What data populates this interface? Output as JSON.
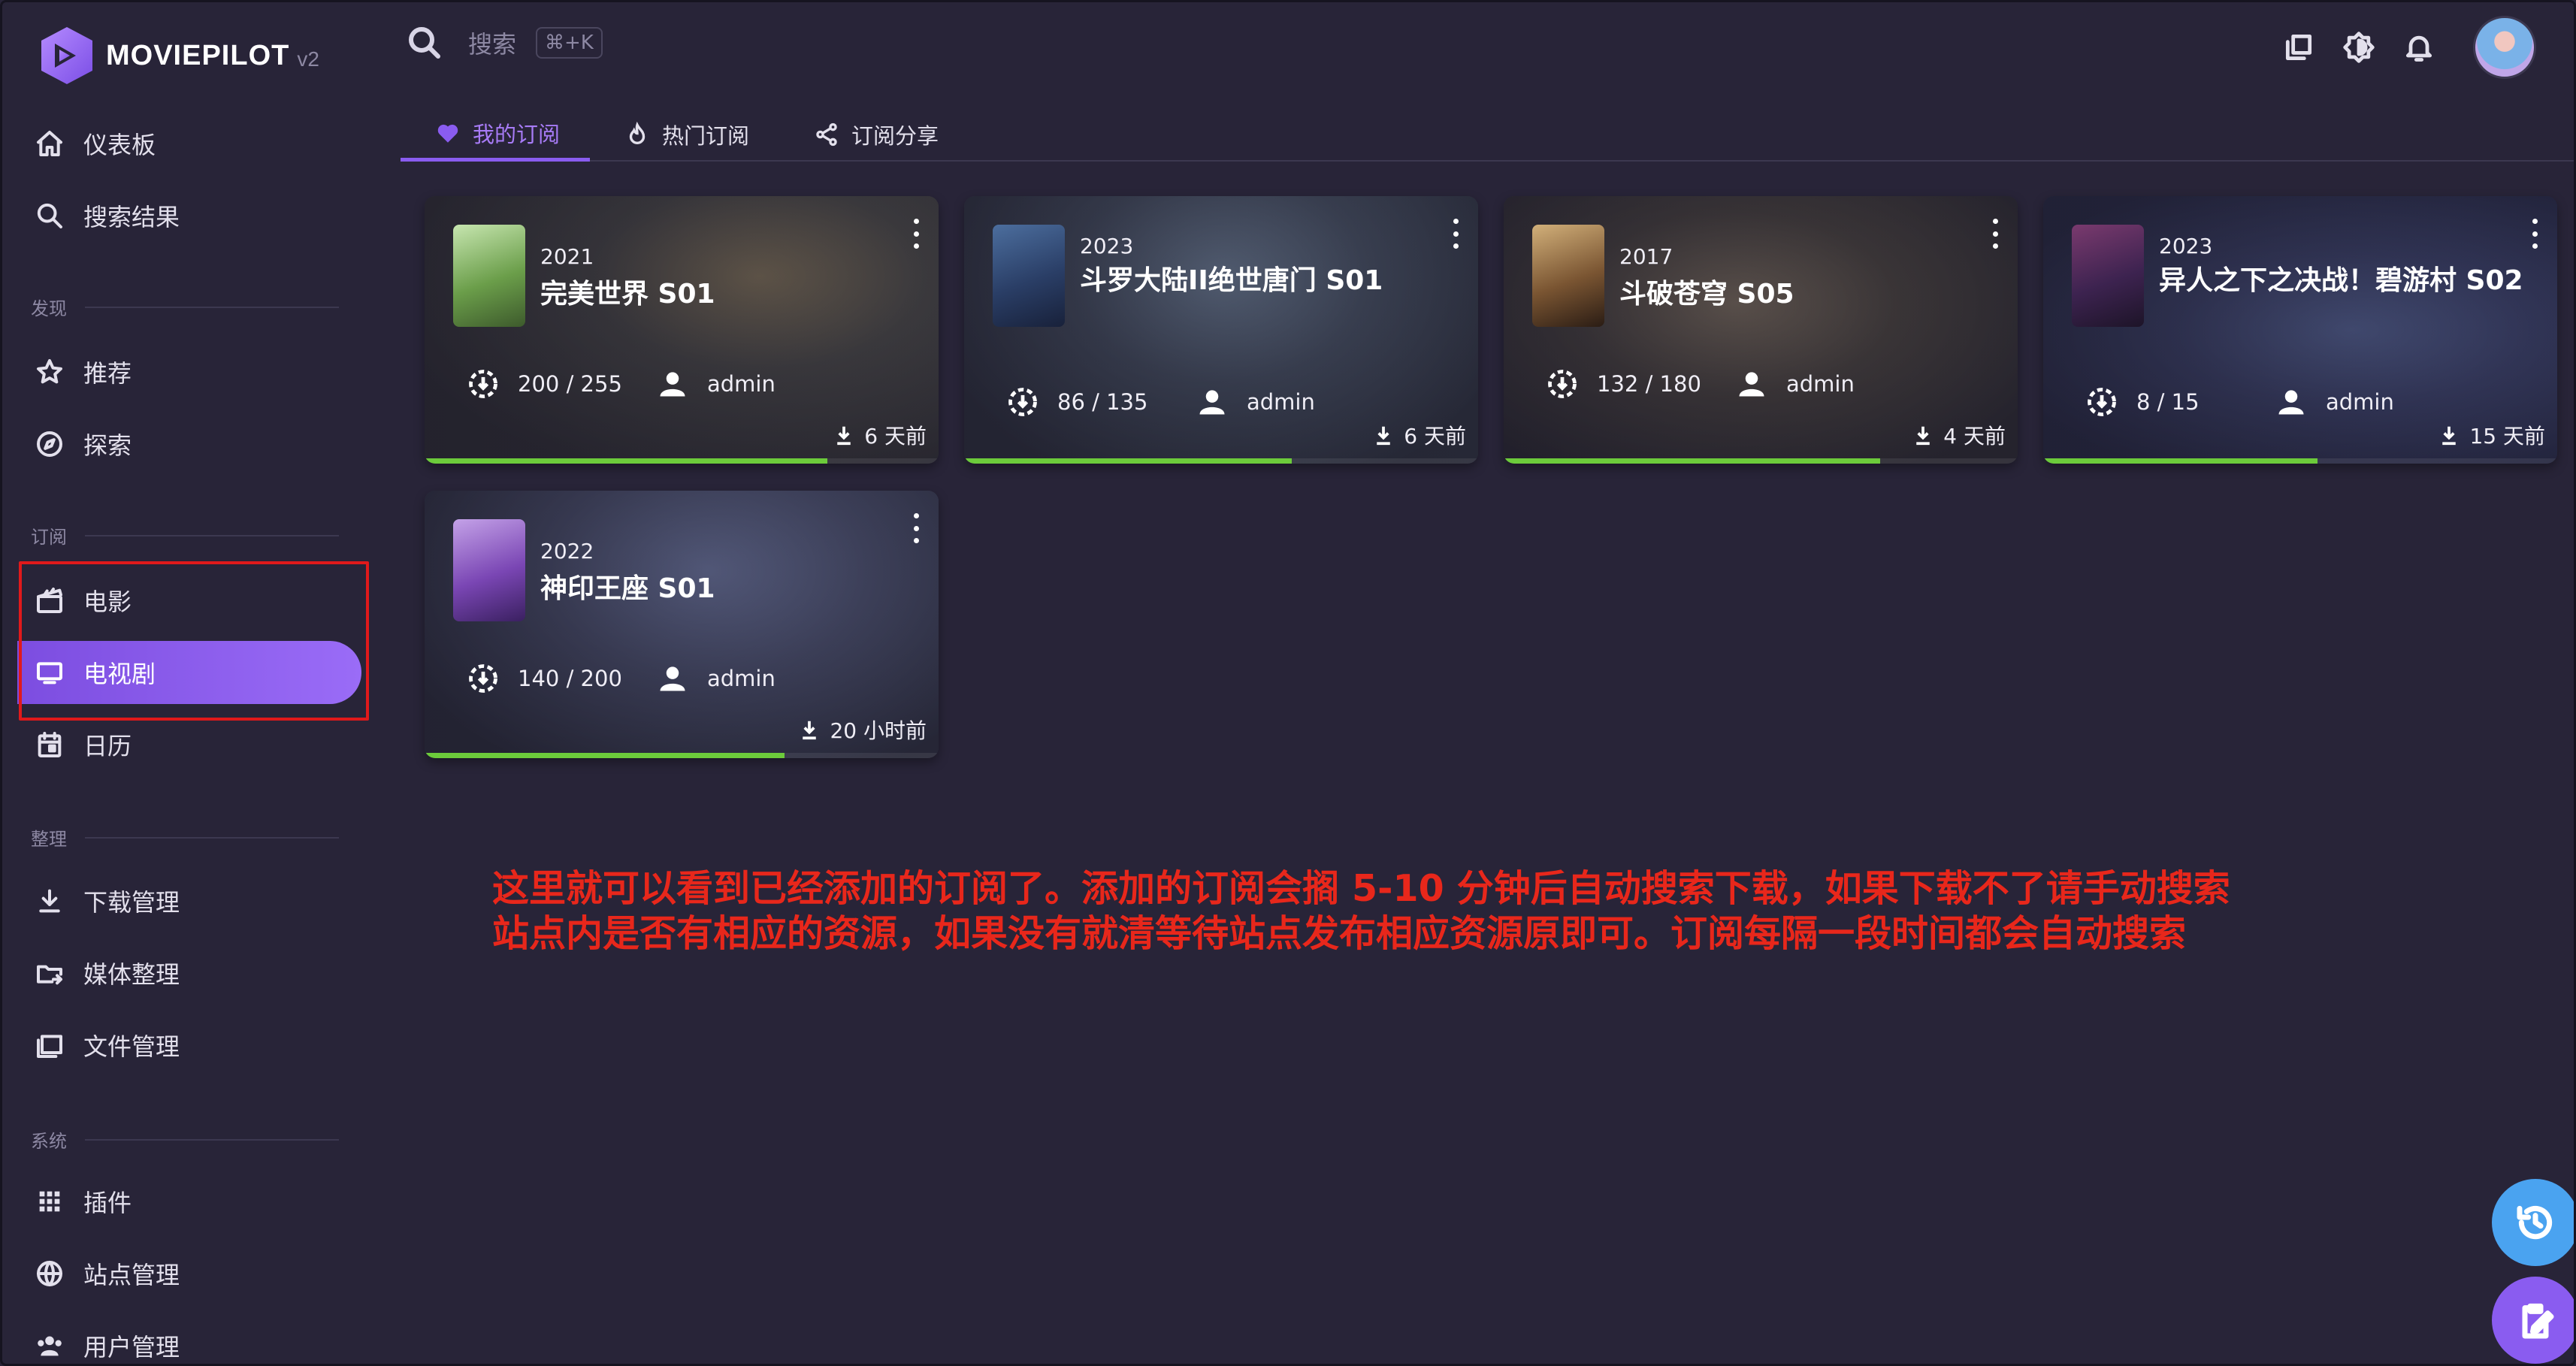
{
  "app": {
    "name": "MOVIEPILOT",
    "version": "v2"
  },
  "search": {
    "placeholder": "搜索",
    "shortcut": "⌘+K"
  },
  "sidebar": {
    "top_items": [
      {
        "label": "仪表板",
        "icon": "home-icon"
      },
      {
        "label": "搜索结果",
        "icon": "search-icon"
      }
    ],
    "sections": [
      {
        "title": "发现",
        "items": [
          {
            "label": "推荐",
            "icon": "star-icon"
          },
          {
            "label": "探索",
            "icon": "compass-icon"
          }
        ]
      },
      {
        "title": "订阅",
        "items": [
          {
            "label": "电影",
            "icon": "movie-clapper-icon"
          },
          {
            "label": "电视剧",
            "icon": "tv-icon",
            "active": true
          },
          {
            "label": "日历",
            "icon": "calendar-icon"
          }
        ]
      },
      {
        "title": "整理",
        "items": [
          {
            "label": "下载管理",
            "icon": "download-icon"
          },
          {
            "label": "媒体整理",
            "icon": "folder-move-icon"
          },
          {
            "label": "文件管理",
            "icon": "file-manager-icon"
          }
        ]
      },
      {
        "title": "系统",
        "items": [
          {
            "label": "插件",
            "icon": "grid-icon"
          },
          {
            "label": "站点管理",
            "icon": "globe-icon"
          },
          {
            "label": "用户管理",
            "icon": "users-icon"
          }
        ]
      }
    ]
  },
  "tabs": [
    {
      "label": "我的订阅",
      "icon": "heart-icon",
      "active": true
    },
    {
      "label": "热门订阅",
      "icon": "fire-icon"
    },
    {
      "label": "订阅分享",
      "icon": "share-icon"
    }
  ],
  "cards": [
    {
      "year": "2021",
      "title": "完美世界 S01",
      "count": "200 / 255",
      "user": "admin",
      "time": "6 天前",
      "progress": 0.784
    },
    {
      "year": "2023",
      "title": "斗罗大陆II绝世唐门 S01",
      "count": "86 / 135",
      "user": "admin",
      "time": "6 天前",
      "progress": 0.637
    },
    {
      "year": "2017",
      "title": "斗破苍穹 S05",
      "count": "132 / 180",
      "user": "admin",
      "time": "4 天前",
      "progress": 0.733
    },
    {
      "year": "2023",
      "title": "异人之下之决战！碧游村 S02",
      "count": "8 / 15",
      "user": "admin",
      "time": "15 天前",
      "progress": 0.533
    },
    {
      "year": "2022",
      "title": "神印王座 S01",
      "count": "140 / 200",
      "user": "admin",
      "time": "20 小时前",
      "progress": 0.7
    }
  ],
  "annotation": {
    "line1": "这里就可以看到已经添加的订阅了。添加的订阅会搁 5-10 分钟后自动搜索下载，如果下载不了请手动搜索",
    "line2": "站点内是否有相应的资源，如果没有就清等待站点发布相应资源原即可。订阅每隔一段时间都会自动搜索"
  },
  "colors": {
    "accent": "#8a5cf0",
    "progress": "#6ccb3b",
    "highlight": "#e0191b",
    "note": "#e8271b",
    "fab_history": "#4aa3f0",
    "fab_clipboard": "#8a5cf0"
  }
}
